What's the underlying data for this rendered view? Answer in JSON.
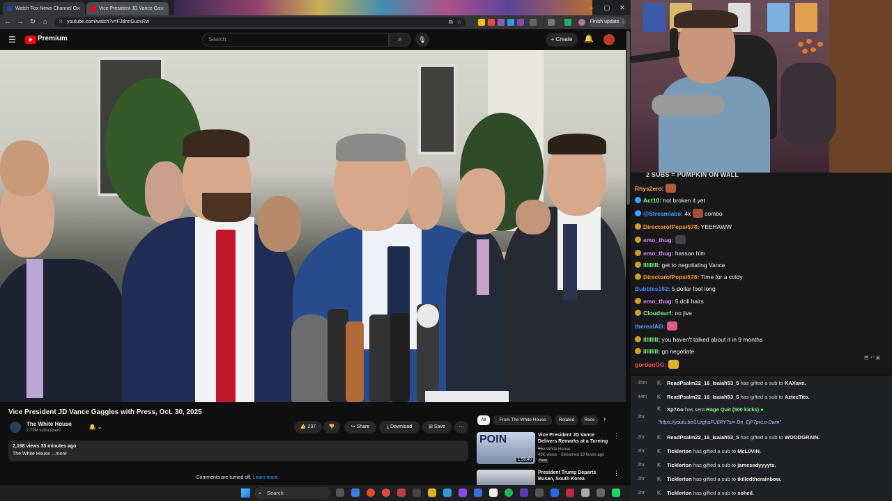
{
  "browser": {
    "tabs": [
      {
        "label": "Watch Fox News Channel O"
      },
      {
        "label": "Vice President JD Vance Ga"
      }
    ],
    "url": "youtube.com/watch?v=FJdnnGuovRw",
    "finish_update_label": "Finish update"
  },
  "youtube": {
    "logo_text": "Premium",
    "search_placeholder": "Search",
    "create_label": "Create"
  },
  "video": {
    "title": "Vice President JD Vance Gaggles with Press, Oct. 30, 2025",
    "channel": {
      "name": "The White House",
      "subscribers": "2.79M subscribers"
    },
    "likes": "237",
    "actions": {
      "share": "Share",
      "download": "Download",
      "save": "Save"
    },
    "description": {
      "stats": "2,198 views  33 minutes ago",
      "text": "The White House  ...more"
    },
    "comments_off": "Comments are turned off.",
    "learn_more": "Learn more"
  },
  "related": {
    "chips": [
      "All",
      "From The White House",
      "Related",
      "Rece"
    ],
    "items": [
      {
        "title": "Vice President JD Vance Delivers Remarks at a Turning ...",
        "channel": "The White House",
        "meta": "49K views · Streamed 19 hours ago",
        "badge": "New",
        "duration": "1:58:40"
      },
      {
        "title": "President Trump Departs Busan, South Korea",
        "channel": "",
        "meta": "",
        "badge": "",
        "duration": ""
      }
    ]
  },
  "chat": {
    "header": "2 SUBS = PUMPKIN ON WALL",
    "messages": [
      {
        "user": "Rhys2ero:",
        "text": "",
        "color": "#ff9a4d"
      },
      {
        "user": "Act10:",
        "text": "not broken it yet",
        "color": "#7dff7d"
      },
      {
        "user": "@Streamlabs:",
        "text": "4x",
        "text2": "combo",
        "color": "#38a7ff"
      },
      {
        "user": "DirectorofPepsi578:",
        "text": "YEEHAWW",
        "color": "#ff9a1a"
      },
      {
        "user": "emo_thug:",
        "text": "",
        "color": "#d98cff"
      },
      {
        "user": "emo_thug:",
        "text": "hassan him",
        "color": "#d98cff"
      },
      {
        "user": "lllllllll:",
        "text": "get to negotiating Vance",
        "color": "#7dff7d"
      },
      {
        "user": "DirectorofPepsi578:",
        "text": "Time for a coldy",
        "color": "#ff9a1a"
      },
      {
        "user": "Bubbles182:",
        "text": "5 dollar foot long",
        "color": "#4d7dff"
      },
      {
        "user": "emo_thug:",
        "text": "5 doll hairs",
        "color": "#d98cff"
      },
      {
        "user": "Cloudsurf:",
        "text": "no jive",
        "color": "#7dff7d"
      },
      {
        "user": "therealAO:",
        "text": "",
        "color": "#4d9dff"
      },
      {
        "user": "lllllllll:",
        "text": "you haven't talked about it in 9 months",
        "color": "#7dff7d"
      },
      {
        "user": "lllllllll:",
        "text": "go negotiate",
        "color": "#7dff7d"
      },
      {
        "user": "gordonGG:",
        "text": "",
        "color": "#ff4d4d"
      }
    ]
  },
  "events": [
    {
      "time": "35m",
      "user": "ReadPsalm22_16_Isaiah53_5",
      "text": "has gifted a sub to",
      "target": "KAXaxe."
    },
    {
      "time": "44m",
      "user": "ReadPsalm22_16_Isaiah53_5",
      "text": "has gifted a sub to",
      "target": "AztecTito."
    },
    {
      "time": "2hr",
      "user": "Xp7Ao",
      "text": "has sent",
      "target": "Rage Quit (500 kicks)",
      "link": "\"https://youtu.be/LUrghaFU0RY?si=-Dn_EjP7pvLo-Dwm\""
    },
    {
      "time": "2hr",
      "user": "ReadPsalm22_16_Isaiah53_5",
      "text": "has gifted a sub to",
      "target": "WOODGRAIN."
    },
    {
      "time": "2hr",
      "user": "Ticklerton",
      "text": "has gifted a sub to",
      "target": "McL0VIN."
    },
    {
      "time": "2hr",
      "user": "Ticklerton",
      "text": "has gifted a sub to",
      "target": "jamesedyyyyts."
    },
    {
      "time": "2hr",
      "user": "Ticklerton",
      "text": "has gifted a sub to",
      "target": "ikilledtherainbow."
    },
    {
      "time": "2hr",
      "user": "Ticklerton",
      "text": "has gifted a sub to",
      "target": "soheil."
    }
  ],
  "taskbar": {
    "search_label": "Search"
  },
  "colors": {
    "yt_red": "#ff0000",
    "link_blue": "#3ea6ff",
    "chat_bg": "#18181b"
  }
}
